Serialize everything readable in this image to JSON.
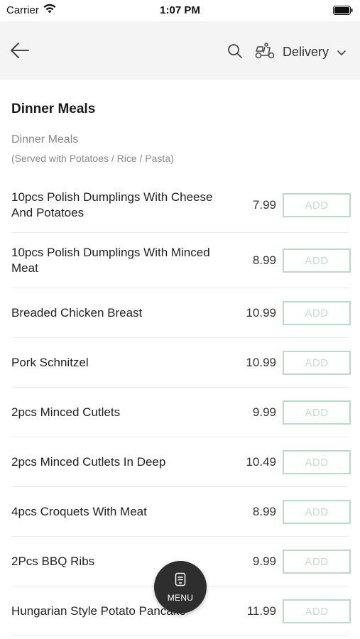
{
  "status_bar": {
    "carrier": "Carrier",
    "time": "1:07 PM",
    "icons": [
      "wifi-icon",
      "battery-icon"
    ]
  },
  "nav": {
    "back_icon": "arrow-left-icon",
    "search_icon": "search-icon",
    "delivery_icon": "scooter-icon",
    "delivery_label": "Delivery",
    "dropdown_icon": "chevron-down-icon"
  },
  "section": {
    "title": "Dinner Meals",
    "category_name": "Dinner Meals",
    "category_desc": "(Served with Potatoes / Rice / Pasta)"
  },
  "items": [
    {
      "name": "10pcs Polish Dumplings With Cheese And Potatoes",
      "price": "7.99",
      "add_label": "ADD"
    },
    {
      "name": "10pcs Polish Dumplings With Minced Meat",
      "price": "8.99",
      "add_label": "ADD"
    },
    {
      "name": "Breaded Chicken Breast",
      "price": "10.99",
      "add_label": "ADD"
    },
    {
      "name": "Pork Schnitzel",
      "price": "10.99",
      "add_label": "ADD"
    },
    {
      "name": "2pcs Minced Cutlets",
      "price": "9.99",
      "add_label": "ADD"
    },
    {
      "name": "2pcs Minced Cutlets In Deep",
      "price": "10.49",
      "add_label": "ADD"
    },
    {
      "name": "4pcs Croquets With Meat",
      "price": "8.99",
      "add_label": "ADD"
    },
    {
      "name": "2Pcs BBQ Ribs",
      "price": "9.99",
      "add_label": "ADD"
    },
    {
      "name": "Hungarian Style Potato Pancake",
      "price": "11.99",
      "add_label": "ADD"
    }
  ],
  "fab": {
    "label": "MENU",
    "icon": "menu-card-icon"
  },
  "colors": {
    "nav_background": "#f4f4f4",
    "add_border": "#b9dcc6",
    "add_text": "#c2e0cc",
    "fab_background": "#2e2e2e"
  }
}
